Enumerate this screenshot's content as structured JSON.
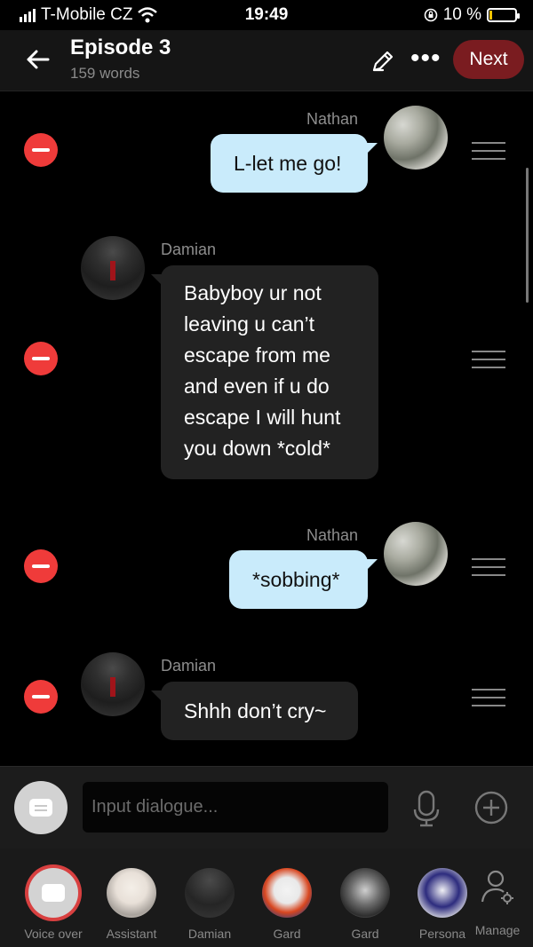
{
  "status_bar": {
    "carrier": "T-Mobile CZ",
    "time": "19:49",
    "battery": "10 %",
    "battery_level": 0.1
  },
  "header": {
    "title": "Episode 3",
    "word_count": "159 words",
    "next_label": "Next"
  },
  "messages": [
    {
      "speaker": "Nathan",
      "text": "L-let me go!",
      "side": "user"
    },
    {
      "speaker": "Damian",
      "text": "Babyboy ur not leaving u can’t escape from me and even if u do escape I will hunt you down *cold*",
      "side": "character"
    },
    {
      "speaker": "Nathan",
      "text": "*sobbing*",
      "side": "user"
    },
    {
      "speaker": "Damian",
      "text": "Shhh don’t cry~",
      "side": "character"
    }
  ],
  "input": {
    "placeholder": "Input dialogue..."
  },
  "characters": [
    {
      "label": "Voice over"
    },
    {
      "label": "Assistant"
    },
    {
      "label": "Damian"
    },
    {
      "label": "Gard"
    },
    {
      "label": "Gard"
    },
    {
      "label": "Persona"
    },
    {
      "label": "Manage"
    }
  ],
  "colors": {
    "next_button": "#7a1c20",
    "user_bubble": "#c9ebfb",
    "char_bubble": "#222222",
    "delete": "#ef3b3a"
  }
}
